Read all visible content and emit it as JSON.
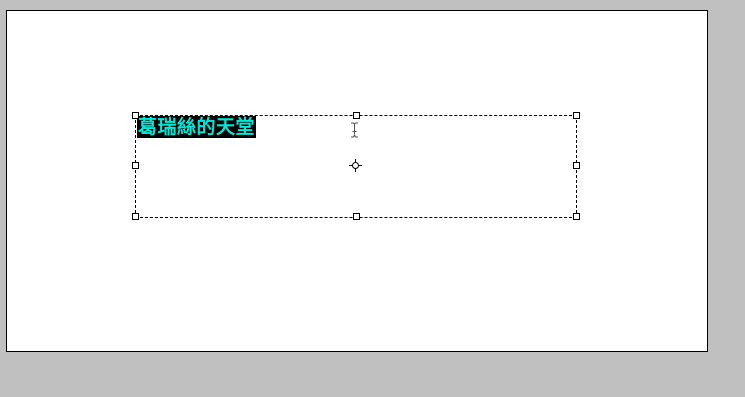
{
  "canvas": {
    "background": "#ffffff",
    "workspace_background": "#c0c0c0",
    "text_layer": {
      "text": "葛瑞絲的天堂",
      "text_color": "#00e8d8",
      "highlight_color": "#000000",
      "selected": true
    },
    "cursor_icon": "text-ibeam-icon",
    "center_marker_icon": "crosshair-icon"
  }
}
